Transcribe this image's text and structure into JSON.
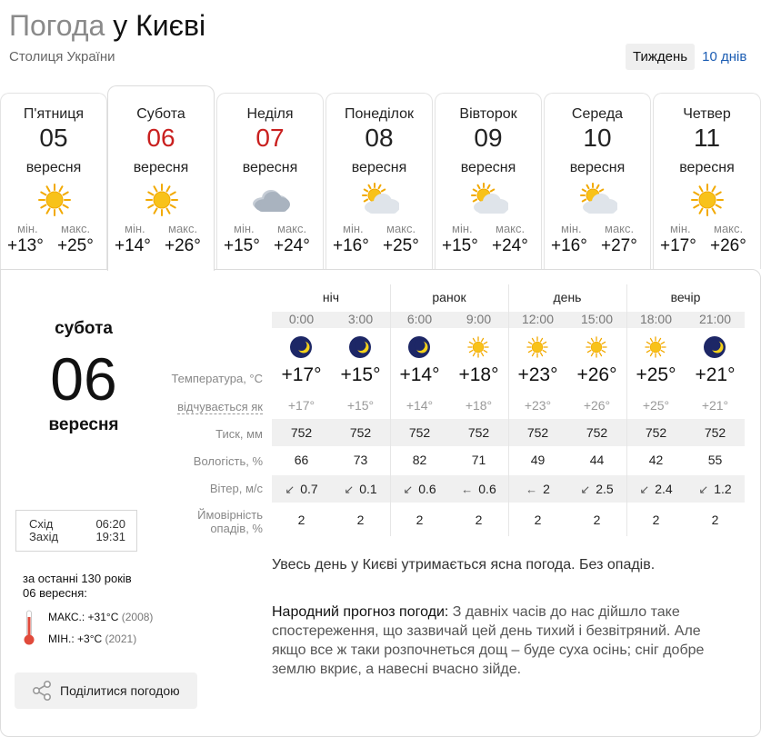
{
  "header": {
    "title_prefix": "Погода",
    "title_rest": " у Києві",
    "subtitle": "Столиця України"
  },
  "range_tabs": [
    {
      "label": "Тиждень",
      "active": true
    },
    {
      "label": "10 днів",
      "active": false
    }
  ],
  "days": [
    {
      "name": "П'ятниця",
      "num": "05",
      "month": "вересня",
      "icon": "sun-icon",
      "min_label": "мін.",
      "max_label": "макс.",
      "min": "+13°",
      "max": "+25°",
      "weekend": false
    },
    {
      "name": "Субота",
      "num": "06",
      "month": "вересня",
      "icon": "sun-icon",
      "min_label": "мін.",
      "max_label": "макс.",
      "min": "+14°",
      "max": "+26°",
      "weekend": true
    },
    {
      "name": "Неділя",
      "num": "07",
      "month": "вересня",
      "icon": "cloud-icon",
      "min_label": "мін.",
      "max_label": "макс.",
      "min": "+15°",
      "max": "+24°",
      "weekend": true
    },
    {
      "name": "Понеділок",
      "num": "08",
      "month": "вересня",
      "icon": "partly-cloudy-icon",
      "min_label": "мін.",
      "max_label": "макс.",
      "min": "+16°",
      "max": "+25°",
      "weekend": false
    },
    {
      "name": "Вівторок",
      "num": "09",
      "month": "вересня",
      "icon": "partly-cloudy-icon",
      "min_label": "мін.",
      "max_label": "макс.",
      "min": "+15°",
      "max": "+24°",
      "weekend": false
    },
    {
      "name": "Середа",
      "num": "10",
      "month": "вересня",
      "icon": "partly-cloudy-icon",
      "min_label": "мін.",
      "max_label": "макс.",
      "min": "+16°",
      "max": "+27°",
      "weekend": false
    },
    {
      "name": "Четвер",
      "num": "11",
      "month": "вересня",
      "icon": "sun-icon",
      "min_label": "мін.",
      "max_label": "макс.",
      "min": "+17°",
      "max": "+26°",
      "weekend": false
    }
  ],
  "selected": {
    "weekday": "субота",
    "day": "06",
    "month": "вересня",
    "sunrise_label": "Схід",
    "sunrise": "06:20",
    "sunset_label": "Захід",
    "sunset": "19:31",
    "history_title": "за останні 130 років",
    "history_date": "06 вересня:",
    "hist_max_label": "МАКС.:",
    "hist_max": "+31°C",
    "hist_max_year": "(2008)",
    "hist_min_label": "МІН.:",
    "hist_min": "+3°C",
    "hist_min_year": "(2021)",
    "share_label": "Поділитися погодою"
  },
  "hourly": {
    "periods": [
      "ніч",
      "ранок",
      "день",
      "вечір"
    ],
    "labels": {
      "temperature": "Температура, °C",
      "feels": "відчувається як",
      "pressure": "Тиск, мм",
      "humidity": "Вологість, %",
      "wind": "Вітер, м/с",
      "precip_line1": "Ймовірність",
      "precip_line2": "опадів, %"
    },
    "slots": [
      {
        "time": "0:00",
        "icon": "moon-icon",
        "temp": "+17°",
        "feels": "+17°",
        "pressure": "752",
        "humidity": "66",
        "wind_arrow": "↙",
        "wind": "0.7",
        "precip": "2"
      },
      {
        "time": "3:00",
        "icon": "moon-icon",
        "temp": "+15°",
        "feels": "+15°",
        "pressure": "752",
        "humidity": "73",
        "wind_arrow": "↙",
        "wind": "0.1",
        "precip": "2"
      },
      {
        "time": "6:00",
        "icon": "moon-icon",
        "temp": "+14°",
        "feels": "+14°",
        "pressure": "752",
        "humidity": "82",
        "wind_arrow": "↙",
        "wind": "0.6",
        "precip": "2"
      },
      {
        "time": "9:00",
        "icon": "sun-icon",
        "temp": "+18°",
        "feels": "+18°",
        "pressure": "752",
        "humidity": "71",
        "wind_arrow": "←",
        "wind": "0.6",
        "precip": "2"
      },
      {
        "time": "12:00",
        "icon": "sun-icon",
        "temp": "+23°",
        "feels": "+23°",
        "pressure": "752",
        "humidity": "49",
        "wind_arrow": "←",
        "wind": "2",
        "precip": "2"
      },
      {
        "time": "15:00",
        "icon": "sun-icon",
        "temp": "+26°",
        "feels": "+26°",
        "pressure": "752",
        "humidity": "44",
        "wind_arrow": "↙",
        "wind": "2.5",
        "precip": "2"
      },
      {
        "time": "18:00",
        "icon": "sun-icon",
        "temp": "+25°",
        "feels": "+25°",
        "pressure": "752",
        "humidity": "42",
        "wind_arrow": "↙",
        "wind": "2.4",
        "precip": "2"
      },
      {
        "time": "21:00",
        "icon": "moon-icon",
        "temp": "+21°",
        "feels": "+21°",
        "pressure": "752",
        "humidity": "55",
        "wind_arrow": "↙",
        "wind": "1.2",
        "precip": "2"
      }
    ]
  },
  "summary": "Увесь день у Києві утримається ясна погода. Без опадів.",
  "folk": {
    "heading": "Народний прогноз погоди:",
    "text": " З давніх часів до нас дійшло таке спостереження, що зазвичай цей день тихий і безвітряний. Але якщо все ж таки розпочнеться дощ – буде суха осінь; сніг добре землю вкриє, а навесні вчасно зійде."
  },
  "colors": {
    "weekend_red": "#c9201f",
    "link_blue": "#1c5db3",
    "sun_yellow": "#f6b40e",
    "moon_sky": "#1d2766"
  }
}
